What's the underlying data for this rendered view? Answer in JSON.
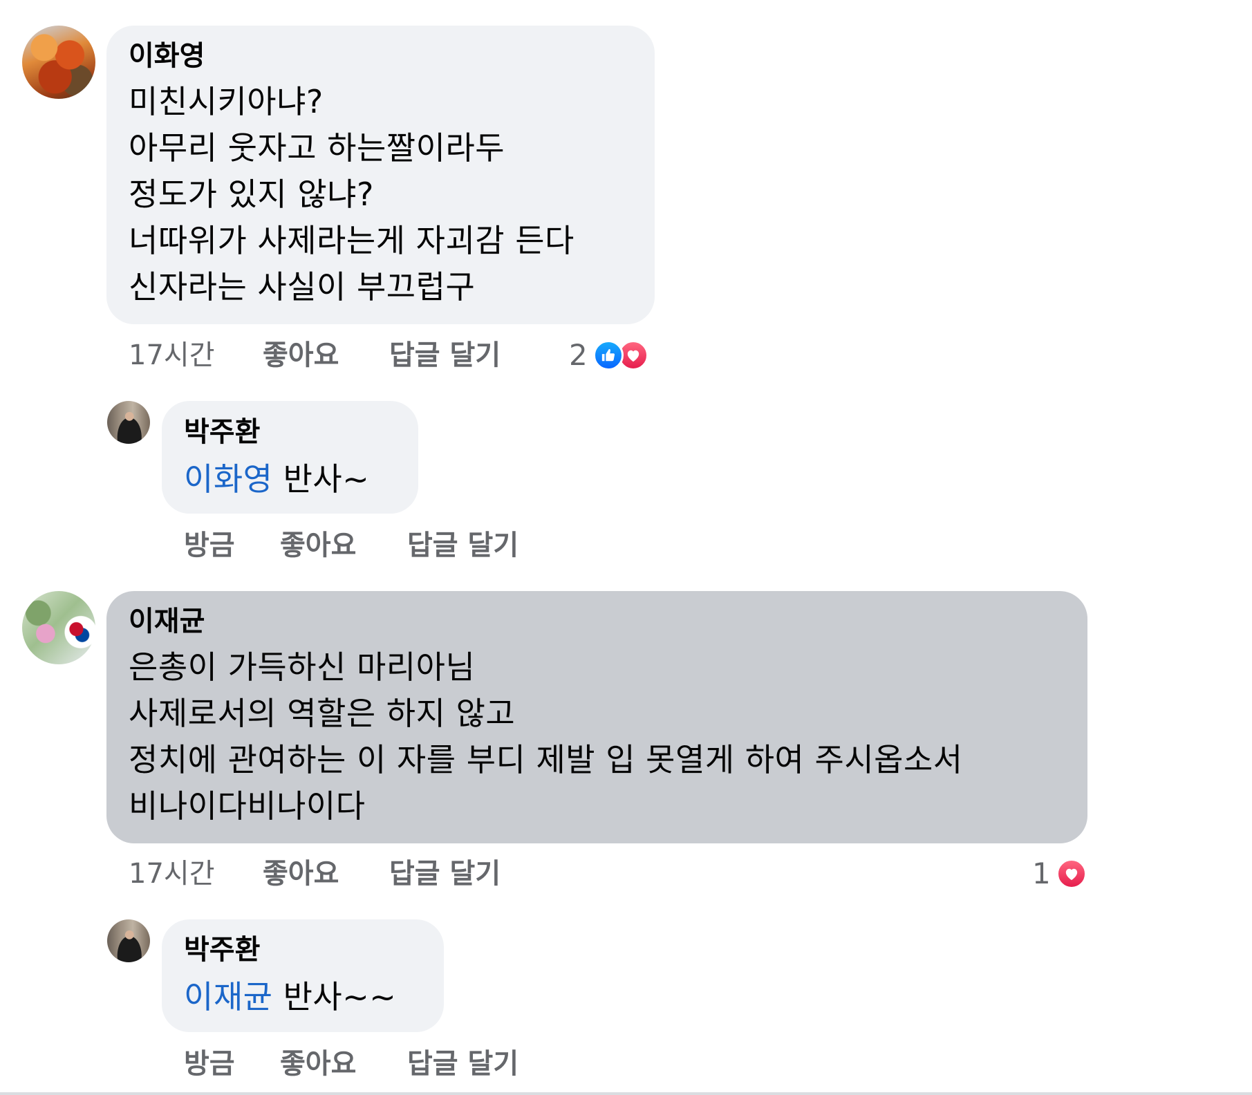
{
  "comments": [
    {
      "author": "이화영",
      "lines": [
        "미친시키아냐?",
        "아무리 웃자고 하는짤이라두",
        "정도가 있지 않냐?",
        "너따위가 사제라는게 자괴감 든다",
        "신자라는 사실이 부끄럽구"
      ],
      "time": "17시간",
      "like_label": "좋아요",
      "reply_label": "답글 달기",
      "reaction_count": "2",
      "reactions": [
        "like-icon",
        "love-icon"
      ],
      "reply": {
        "author": "박주환",
        "mention": "이화영",
        "text": " 반사~",
        "time": "방금",
        "like_label": "좋아요",
        "reply_label": "답글 달기"
      }
    },
    {
      "author": "이재균",
      "lines": [
        "은총이 가득하신 마리아님",
        "사제로서의 역할은 하지 않고",
        "정치에 관여하는 이 자를 부디 제발 입 못열게 하여 주시옵소서",
        "비나이다비나이다"
      ],
      "time": "17시간",
      "like_label": "좋아요",
      "reply_label": "답글 달기",
      "reaction_count": "1",
      "reactions": [
        "love-icon"
      ],
      "reply": {
        "author": "박주환",
        "mention": "이재균",
        "text": " 반사~~",
        "time": "방금",
        "like_label": "좋아요",
        "reply_label": "답글 달기"
      }
    }
  ],
  "colors": {
    "bubble": "#f0f2f5",
    "bubble_selected": "#c9ccd1",
    "mention": "#1b66c9",
    "meta_text": "#65676b",
    "like": "#0866ff",
    "love": "#e61e4d"
  }
}
